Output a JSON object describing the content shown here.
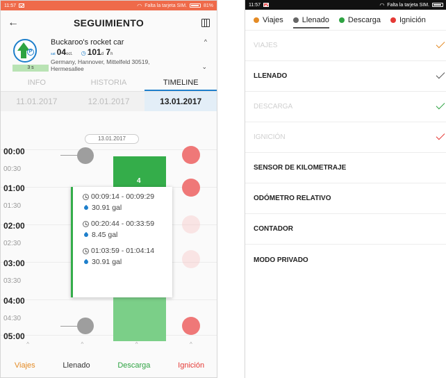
{
  "left": {
    "status_time": "11:57",
    "status_right": "Falta la tarjeta SIM.",
    "status_battery": "81%",
    "title": "SEGUIMIENTO",
    "vehicle": {
      "name": "Buckaroo's rocket car",
      "secs": "3 s",
      "date_tag": "sat",
      "date_day": "04",
      "date_month": "oct.",
      "duration_days": "101",
      "duration_d": "d",
      "duration_hours": "7",
      "duration_h": "h",
      "address_line1": "Germany, Hannover, Mittelfeld 30519,",
      "address_line2": "Hermesallee"
    },
    "tabs": [
      "INFO",
      "HISTORIA",
      "TIMELINE"
    ],
    "dates": [
      "11.01.2017",
      "12.01.2017",
      "13.01.2017"
    ],
    "date_pill": "13.01.2017",
    "times": [
      "00:00",
      "00:30",
      "01:00",
      "01:30",
      "02:00",
      "02:30",
      "03:00",
      "03:30",
      "04:00",
      "04:30",
      "05:00"
    ],
    "bar_count": "4",
    "popup": [
      {
        "time": "00:09:14 - 00:09:29",
        "gal": "30.91 gal"
      },
      {
        "time": "00:20:44 - 00:33:59",
        "gal": "8.45 gal"
      },
      {
        "time": "01:03:59 - 01:04:14",
        "gal": "30.91 gal"
      }
    ],
    "legend": [
      "Viajes",
      "Llenado",
      "Descarga",
      "Ignición"
    ],
    "colors": {
      "viajes": "#e48b25",
      "llenado": "#333333",
      "descarga": "#2ea342",
      "ignicion": "#e53935",
      "accent": "#1e7fcb"
    }
  },
  "right": {
    "status_time": "11:57",
    "status_right": "Falta la tarjeta SIM.",
    "legend": [
      {
        "label": "Viajes",
        "color": "#e48b25"
      },
      {
        "label": "Llenado",
        "color": "#666666"
      },
      {
        "label": "Descarga",
        "color": "#2ea342"
      },
      {
        "label": "Ignición",
        "color": "#e53935"
      }
    ],
    "rows": [
      {
        "label": "VIAJES",
        "check_color": "#e48b25",
        "enabled": false
      },
      {
        "label": "LLENADO",
        "check_color": "#555555",
        "enabled": true
      },
      {
        "label": "DESCARGA",
        "check_color": "#2ea342",
        "enabled": false
      },
      {
        "label": "IGNICIÓN",
        "check_color": "#e53935",
        "enabled": false
      },
      {
        "label": "SENSOR DE KILOMETRAJE",
        "enabled": true
      },
      {
        "label": "ODÓMETRO RELATIVO",
        "enabled": true
      },
      {
        "label": "CONTADOR",
        "enabled": true
      },
      {
        "label": "MODO PRIVADO",
        "enabled": true
      }
    ]
  }
}
